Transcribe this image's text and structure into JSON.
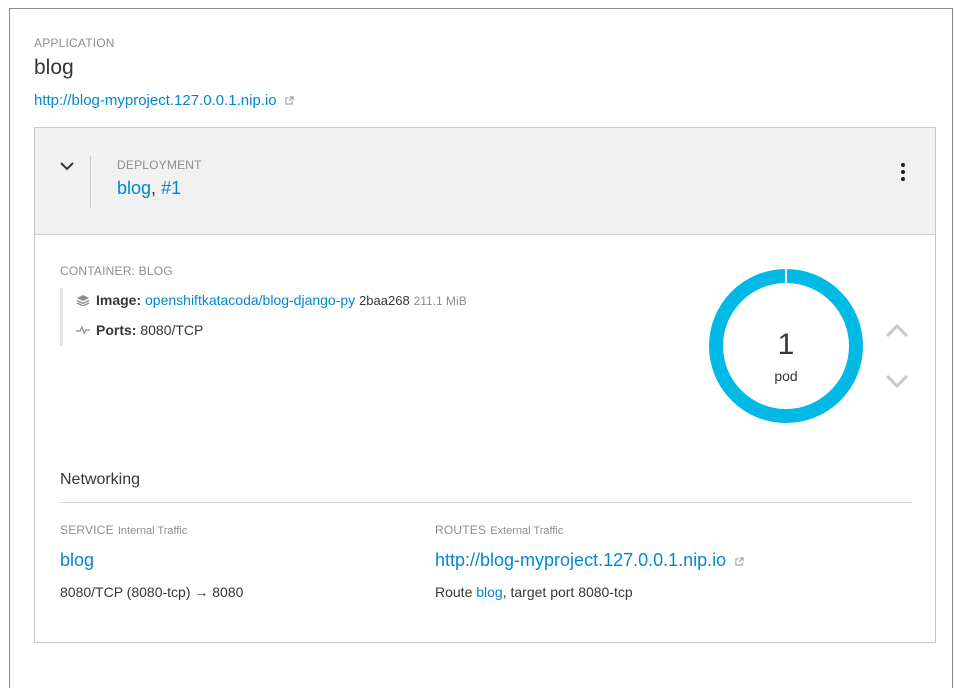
{
  "application": {
    "caption": "APPLICATION",
    "name": "blog",
    "url": "http://blog-myproject.127.0.0.1.nip.io"
  },
  "deployment": {
    "caption": "DEPLOYMENT",
    "name": "blog",
    "separator": ",",
    "revision": "#1"
  },
  "container": {
    "caption": "CONTAINER: BLOG",
    "image_label": "Image:",
    "image_name": "openshiftkatacoda/blog-django-py",
    "image_id": "2baa268",
    "image_size": "211.1 MiB",
    "ports_label": "Ports:",
    "ports_value": "8080/TCP"
  },
  "pods": {
    "count": "1",
    "label": "pod",
    "ring_fraction": 1.0
  },
  "networking": {
    "title": "Networking",
    "service": {
      "caption": "SERVICE",
      "subcaption": "Internal Traffic",
      "name": "blog",
      "mapping": "8080/TCP (8080-tcp) → 8080"
    },
    "routes": {
      "caption": "ROUTES",
      "subcaption": "External Traffic",
      "url": "http://blog-myproject.127.0.0.1.nip.io",
      "route_prefix": "Route",
      "route_name": "blog",
      "route_suffix": ", target port 8080-tcp"
    }
  },
  "colors": {
    "link": "#0088ce",
    "donut": "#00b9e4",
    "header_bg": "#f1f1f1"
  },
  "icons": {
    "external_link": "external-link-icon",
    "image": "layers-icon",
    "ports": "pulse-icon",
    "kebab": "kebab-menu-icon",
    "collapse": "chevron-down-icon",
    "scale_up": "chevron-up-icon",
    "scale_down": "chevron-down-icon"
  }
}
